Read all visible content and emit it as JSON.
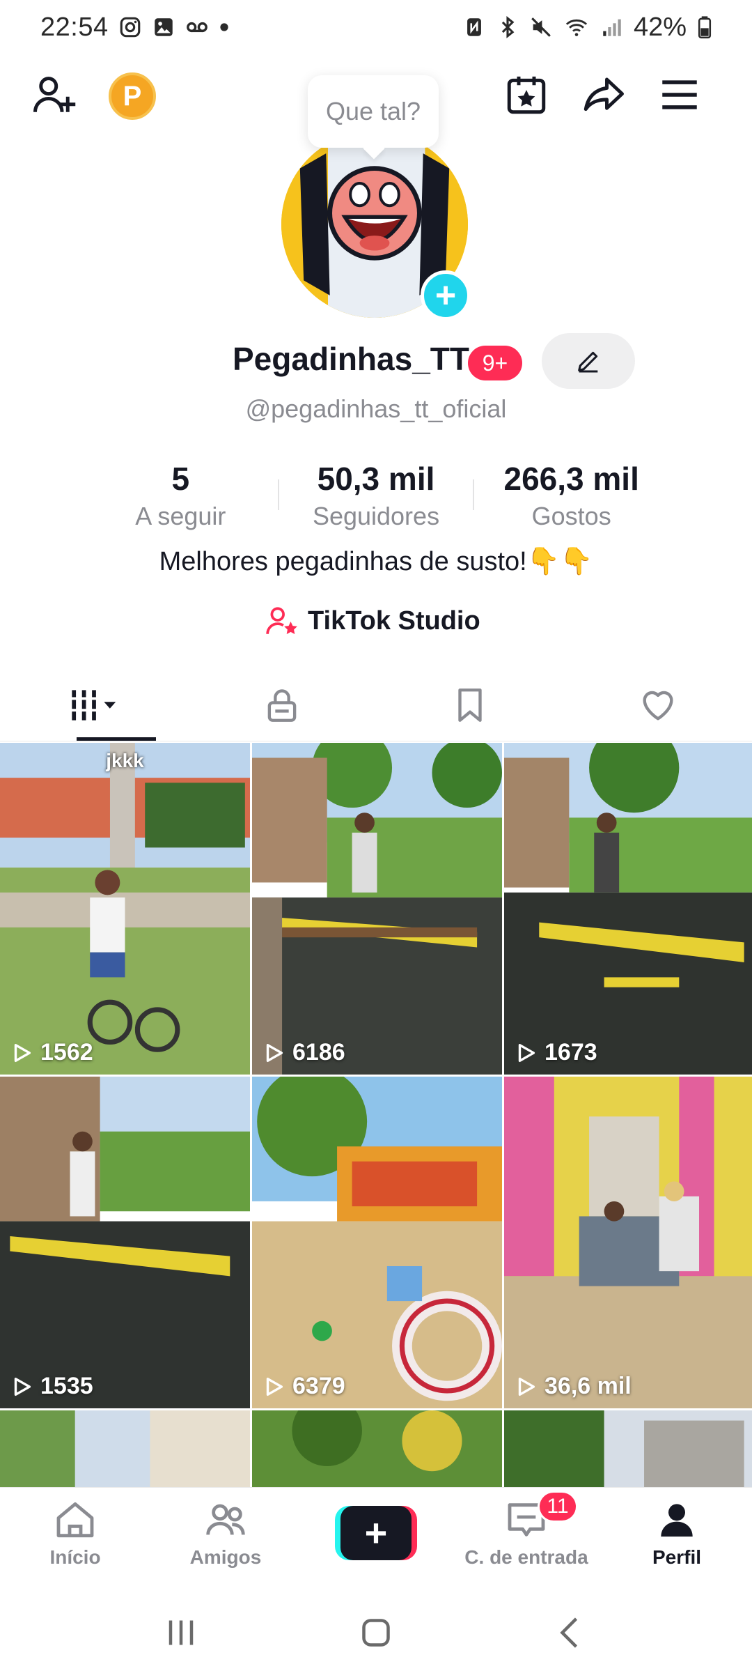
{
  "status_bar": {
    "time": "22:54",
    "battery": "42%",
    "left_icons": [
      "instagram-icon",
      "gallery-icon",
      "voicemail-icon",
      "dot-icon"
    ],
    "right_icons": [
      "nfc-icon",
      "bluetooth-icon",
      "mute-icon",
      "wifi-icon",
      "signal-icon",
      "battery-icon"
    ]
  },
  "top_bar": {
    "coin_letter": "P",
    "tooltip": "Que tal?",
    "icons": [
      "add-friend-icon",
      "coin-icon",
      "calendar-star-icon",
      "share-icon",
      "menu-icon"
    ]
  },
  "profile": {
    "username": "Pegadinhas_TT",
    "badge": "9+",
    "handle": "@pegadinhas_tt_oficial",
    "bio": "Melhores pegadinhas de susto!👇👇",
    "studio_label": "TikTok Studio"
  },
  "stats": [
    {
      "value": "5",
      "label": "A seguir"
    },
    {
      "value": "50,3 mil",
      "label": "Seguidores"
    },
    {
      "value": "266,3 mil",
      "label": "Gostos"
    }
  ],
  "tabs": [
    "videos-grid-icon",
    "lock-icon",
    "bookmark-icon",
    "heart-icon"
  ],
  "videos": [
    {
      "tag": "jkkk",
      "views": "1562"
    },
    {
      "tag": "",
      "views": "6186"
    },
    {
      "tag": "",
      "views": "1673"
    },
    {
      "tag": "",
      "views": "1535"
    },
    {
      "tag": "",
      "views": "6379"
    },
    {
      "tag": "",
      "views": "36,6 mil"
    }
  ],
  "bottom_nav": {
    "home": "Início",
    "friends": "Amigos",
    "inbox": "C. de entrada",
    "inbox_badge": "11",
    "profile": "Perfil"
  },
  "colors": {
    "accent": "#fe2c55",
    "cyan": "#25f4ee",
    "text": "#161823",
    "muted": "#8a8b91"
  }
}
